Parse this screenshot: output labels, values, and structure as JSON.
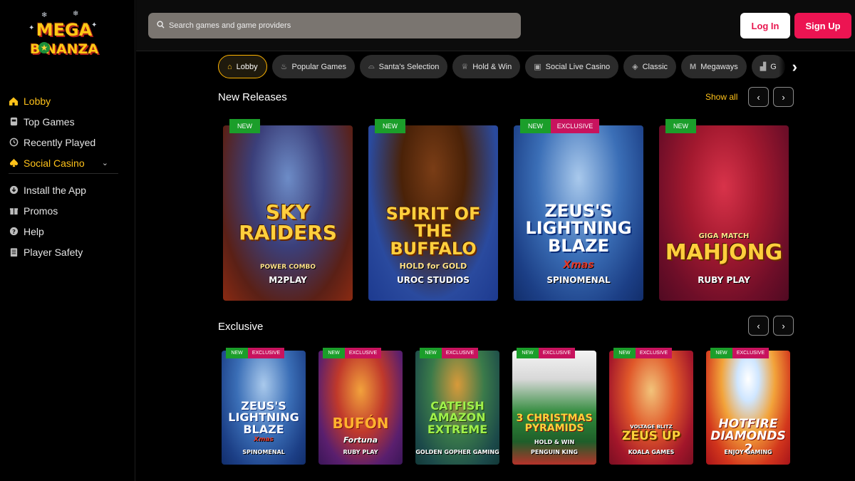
{
  "logo": {
    "line1": "MEGA",
    "line2": "B  NANZA"
  },
  "sidebar": {
    "items": [
      {
        "label": "Lobby",
        "icon": "home-icon"
      },
      {
        "label": "Top Games",
        "icon": "trophy-icon"
      },
      {
        "label": "Recently Played",
        "icon": "history-icon"
      },
      {
        "label": "Social Casino",
        "icon": "spade-icon"
      },
      {
        "label": "Install the App",
        "icon": "download-icon"
      },
      {
        "label": "Promos",
        "icon": "gift-icon"
      },
      {
        "label": "Help",
        "icon": "help-icon"
      },
      {
        "label": "Player Safety",
        "icon": "document-icon"
      }
    ]
  },
  "header": {
    "search_placeholder": "Search games and game providers",
    "login_label": "Log In",
    "signup_label": "Sign Up"
  },
  "categories": [
    {
      "label": "Lobby",
      "icon": "home-icon"
    },
    {
      "label": "Popular Games",
      "icon": "flame-icon"
    },
    {
      "label": "Santa's Selection",
      "icon": "hat-icon"
    },
    {
      "label": "Hold & Win",
      "icon": "trophy-icon"
    },
    {
      "label": "Social Live Casino",
      "icon": "cards-icon"
    },
    {
      "label": "Classic",
      "icon": "shield-icon"
    },
    {
      "label": "Megaways",
      "icon": "m-icon"
    },
    {
      "label": "G",
      "icon": "chart-icon"
    }
  ],
  "sections": {
    "new_releases": {
      "title": "New Releases",
      "show_all": "Show all",
      "games": [
        {
          "title": "SKY RAIDERS",
          "subtitle": "POWER COMBO",
          "provider": "M2PLAY",
          "badges": [
            "NEW"
          ]
        },
        {
          "title": "SPIRIT OF THE BUFFALO",
          "subtitle": "HOLD for GOLD",
          "provider": "UROC STUDIOS",
          "badges": [
            "NEW"
          ]
        },
        {
          "title": "ZEUS'S LIGHTNING BLAZE",
          "subtitle": "Xmas",
          "provider": "SPINOMENAL",
          "badges": [
            "NEW",
            "EXCLUSIVE"
          ]
        },
        {
          "title": "MAHJONG",
          "subtitle": "GIGA MATCH",
          "provider": "RUBY PLAY",
          "badges": [
            "NEW"
          ]
        }
      ]
    },
    "exclusive": {
      "title": "Exclusive",
      "games": [
        {
          "title": "ZEUS'S LIGHTNING BLAZE",
          "subtitle": "Xmas",
          "provider": "SPINOMENAL",
          "badges": [
            "NEW",
            "EXCLUSIVE"
          ]
        },
        {
          "title": "BUFÓN",
          "subtitle": "Fortuna",
          "provider": "RUBY PLAY",
          "badges": [
            "NEW",
            "EXCLUSIVE"
          ]
        },
        {
          "title": "CATFISH AMAZON EXTREME",
          "subtitle": "",
          "provider": "GOLDEN GOPHER GAMING",
          "badges": [
            "NEW",
            "EXCLUSIVE"
          ]
        },
        {
          "title": "3 CHRISTMAS PYRAMIDS",
          "subtitle": "HOLD & WIN",
          "provider": "PENGUIN KING",
          "badges": [
            "NEW",
            "EXCLUSIVE"
          ]
        },
        {
          "title": "ZEUS UP",
          "subtitle": "VOLTAGE BLITZ",
          "provider": "KOALA GAMES",
          "badges": [
            "NEW",
            "EXCLUSIVE"
          ]
        },
        {
          "title": "HOTFIRE DIAMONDS 2",
          "subtitle": "",
          "provider": "ENJOY GAMING",
          "badges": [
            "NEW",
            "EXCLUSIVE"
          ]
        }
      ]
    }
  },
  "colors": {
    "accent": "#ffc21a",
    "signup": "#ec1452",
    "badge_new": "#1b9e2a",
    "badge_exclusive": "#c8135e"
  }
}
